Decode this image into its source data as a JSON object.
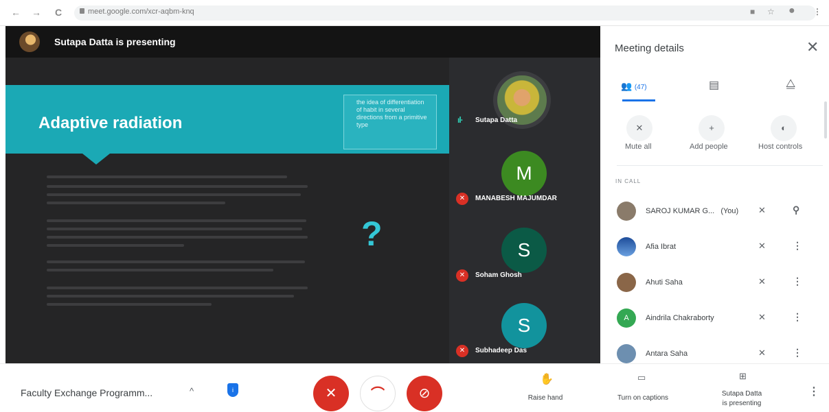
{
  "browser": {
    "back": "←",
    "forward": "→",
    "reload": "C",
    "url": "meet.google.com/xcr-aqbm-knq",
    "right_icons": [
      "camera-icon",
      "star-icon",
      "profile-icon",
      "menu-icon"
    ]
  },
  "stage": {
    "presenter_banner": "Sutapa Datta is presenting",
    "slide": {
      "title": "Adaptive radiation",
      "definition": "the idea of differentiation of habit in several directions from a primitive type",
      "question_mark": "?"
    },
    "tiles": [
      {
        "name": "Sutapa Datta",
        "type": "photo",
        "speaking": true
      },
      {
        "name": "MANABESH MAJUMDAR",
        "letter": "M",
        "color": "#3c8a21",
        "muted": true
      },
      {
        "name": "Soham Ghosh",
        "letter": "S",
        "color": "#0b5a46",
        "muted": true
      },
      {
        "name": "Subhadeep Das",
        "letter": "S",
        "color": "#12939d",
        "muted": true
      }
    ]
  },
  "panel": {
    "title": "Meeting details",
    "people_count": "(47)",
    "actions": [
      {
        "label": "Mute all",
        "icon": "mic-off-icon"
      },
      {
        "label": "Add people",
        "icon": "add-person-icon"
      },
      {
        "label": "Host controls",
        "icon": "toggle-icon"
      }
    ],
    "section_label": "IN CALL",
    "participants": [
      {
        "name": "SAROJ KUMAR G...",
        "suffix": "(You)",
        "avatar_color": "#8a7b6a",
        "initial": ""
      },
      {
        "name": "Afia Ibrat",
        "suffix": "",
        "avatar_color": "#2a5fa8",
        "initial": ""
      },
      {
        "name": "Ahuti Saha",
        "suffix": "",
        "avatar_color": "#8a6648",
        "initial": ""
      },
      {
        "name": "Aindrila Chakraborty",
        "suffix": "",
        "avatar_color": "#34a853",
        "initial": "A"
      },
      {
        "name": "Antara Saha",
        "suffix": "",
        "avatar_color": "#6d8fb0",
        "initial": ""
      }
    ]
  },
  "bottom": {
    "meeting_name": "Faculty Exchange Programm...",
    "raise_hand": "Raise hand",
    "captions": "Turn on captions",
    "presenting_line1": "Sutapa Datta",
    "presenting_line2": "is presenting"
  }
}
